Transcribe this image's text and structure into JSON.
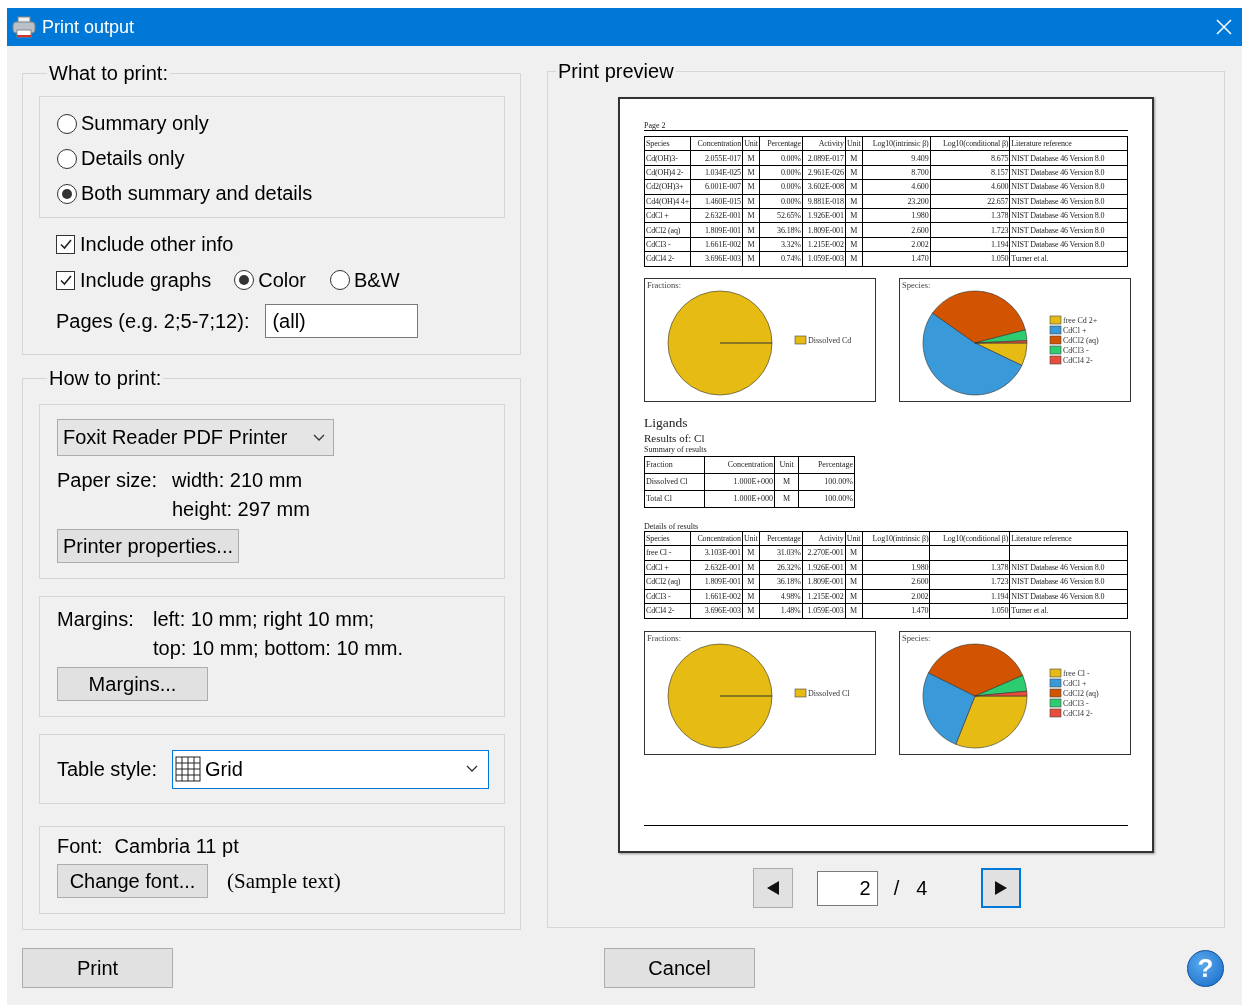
{
  "window": {
    "title": "Print output"
  },
  "what_to_print": {
    "title": "What to print:",
    "content_options": [
      {
        "label": "Summary only",
        "selected": false
      },
      {
        "label": "Details only",
        "selected": false
      },
      {
        "label": "Both summary and details",
        "selected": true
      }
    ],
    "include_other_info": {
      "label": "Include other info",
      "checked": true
    },
    "include_graphs": {
      "label": "Include graphs",
      "checked": true
    },
    "graph_color": [
      {
        "label": "Color",
        "selected": true
      },
      {
        "label": "B&W",
        "selected": false
      }
    ],
    "pages": {
      "label": "Pages (e.g. 2;5-7;12):",
      "value": "(all)"
    }
  },
  "how_to_print": {
    "title": "How to print:",
    "printer": {
      "value": "Foxit Reader PDF Printer"
    },
    "paper_size": {
      "label": "Paper size:",
      "width": "width: 210 mm",
      "height": "height: 297 mm"
    },
    "printer_properties_button": "Printer properties...",
    "margins": {
      "label": "Margins:",
      "lines": [
        "left: 10 mm; right 10 mm;",
        "top: 10 mm; bottom: 10 mm."
      ],
      "button": "Margins..."
    },
    "table_style": {
      "label": "Table style:",
      "value": "Grid"
    },
    "font": {
      "label": "Font:",
      "value": "Cambria 11 pt",
      "button": "Change font...",
      "sample": "(Sample text)"
    }
  },
  "print_preview": {
    "title": "Print preview",
    "page": {
      "header": "Page 2",
      "species_table": {
        "columns": [
          "Species",
          "Concentration",
          "Unit",
          "Percentage",
          "Activity",
          "Unit",
          "Log10(intrinsic β)",
          "Log10(conditional β)",
          "Literature reference"
        ],
        "rows": [
          [
            "Cd(OH)3-",
            "2.055E-017",
            "M",
            "0.00%",
            "2.089E-017",
            "M",
            "9.409",
            "8.675",
            "NIST Database 46 Version 8.0"
          ],
          [
            "Cd(OH)4 2-",
            "1.034E-025",
            "M",
            "0.00%",
            "2.961E-026",
            "M",
            "8.700",
            "8.157",
            "NIST Database 46 Version 8.0"
          ],
          [
            "Cd2(OH)3+",
            "6.001E-007",
            "M",
            "0.00%",
            "3.602E-008",
            "M",
            "4.600",
            "4.600",
            "NIST Database 46 Version 8.0"
          ],
          [
            "Cd4(OH)4 4+",
            "1.460E-015",
            "M",
            "0.00%",
            "9.881E-018",
            "M",
            "23.200",
            "22.657",
            "NIST Database 46 Version 8.0"
          ],
          [
            "CdCl +",
            "2.632E-001",
            "M",
            "52.65%",
            "1.926E-001",
            "M",
            "1.980",
            "1.378",
            "NIST Database 46 Version 8.0"
          ],
          [
            "CdCl2 (aq)",
            "1.809E-001",
            "M",
            "36.18%",
            "1.809E-001",
            "M",
            "2.600",
            "1.723",
            "NIST Database 46 Version 8.0"
          ],
          [
            "CdCl3 -",
            "1.661E-002",
            "M",
            "3.32%",
            "1.215E-002",
            "M",
            "2.002",
            "1.194",
            "NIST Database 46 Version 8.0"
          ],
          [
            "CdCl4 2-",
            "3.696E-003",
            "M",
            "0.74%",
            "1.059E-003",
            "M",
            "1.470",
            "1.050",
            "Turner et al."
          ]
        ]
      },
      "charts": [
        {
          "chart_data": {
            "type": "pie",
            "title": "Fractions:",
            "categories": [
              "Dissolved Cd"
            ],
            "series": [
              {
                "values": [
                  100
                ]
              }
            ],
            "colors": [
              "#e6bc14"
            ],
            "legend": true
          }
        },
        {
          "chart_data": {
            "type": "pie",
            "title": "Species:",
            "categories": [
              "free Cd 2+",
              "CdCl +",
              "CdCl2 (aq)",
              "CdCl3 -",
              "CdCl4 2-"
            ],
            "series": [
              {
                "values": [
                  7.11,
                  52.65,
                  36.18,
                  3.32,
                  0.74
                ]
              }
            ],
            "colors": [
              "#e6bc14",
              "#3a9ad9",
              "#d35400",
              "#2ecc71",
              "#e74c3c"
            ],
            "legend": true
          }
        }
      ],
      "ligands_heading": "Ligands",
      "results_heading": "Results of: Cl",
      "summary_caption": "Summary of results",
      "summary_table": {
        "columns": [
          "Fraction",
          "Concentration",
          "Unit",
          "Percentage"
        ],
        "rows": [
          [
            "Dissolved Cl",
            "1.000E+000",
            "M",
            "100.00%"
          ],
          [
            "Total Cl",
            "1.000E+000",
            "M",
            "100.00%"
          ]
        ]
      },
      "details_caption": "Details of results",
      "details_table": {
        "columns": [
          "Species",
          "Concentration",
          "Unit",
          "Percentage",
          "Activity",
          "Unit",
          "Log10(intrinsic β)",
          "Log10(conditional β)",
          "Literature reference"
        ],
        "rows": [
          [
            "free Cl -",
            "3.103E-001",
            "M",
            "31.03%",
            "2.270E-001",
            "M"
          ],
          [
            "CdCl +",
            "2.632E-001",
            "M",
            "26.32%",
            "1.926E-001",
            "M",
            "1.980",
            "1.378",
            "NIST Database 46 Version 8.0"
          ],
          [
            "CdCl2 (aq)",
            "1.809E-001",
            "M",
            "36.18%",
            "1.809E-001",
            "M",
            "2.600",
            "1.723",
            "NIST Database 46 Version 8.0"
          ],
          [
            "CdCl3 -",
            "1.661E-002",
            "M",
            "4.98%",
            "1.215E-002",
            "M",
            "2.002",
            "1.194",
            "NIST Database 46 Version 8.0"
          ],
          [
            "CdCl4 2-",
            "3.696E-003",
            "M",
            "1.48%",
            "1.059E-003",
            "M",
            "1.470",
            "1.050",
            "Turner et al."
          ]
        ]
      },
      "ligand_charts": [
        {
          "chart_data": {
            "type": "pie",
            "title": "Fractions:",
            "categories": [
              "Dissolved Cl"
            ],
            "series": [
              {
                "values": [
                  100
                ]
              }
            ],
            "colors": [
              "#e6bc14"
            ],
            "legend": true
          }
        },
        {
          "chart_data": {
            "type": "pie",
            "title": "Species:",
            "categories": [
              "free Cl -",
              "CdCl +",
              "CdCl2 (aq)",
              "CdCl3 -",
              "CdCl4 2-"
            ],
            "series": [
              {
                "values": [
                  31.03,
                  26.32,
                  36.18,
                  4.98,
                  1.48
                ]
              }
            ],
            "colors": [
              "#e6bc14",
              "#3a9ad9",
              "#d35400",
              "#2ecc71",
              "#e74c3c"
            ],
            "legend": true
          }
        }
      ]
    },
    "navigation": {
      "page": "2",
      "separator": "/",
      "total": "4"
    }
  },
  "buttons": {
    "print": "Print",
    "cancel": "Cancel",
    "help": "?"
  }
}
